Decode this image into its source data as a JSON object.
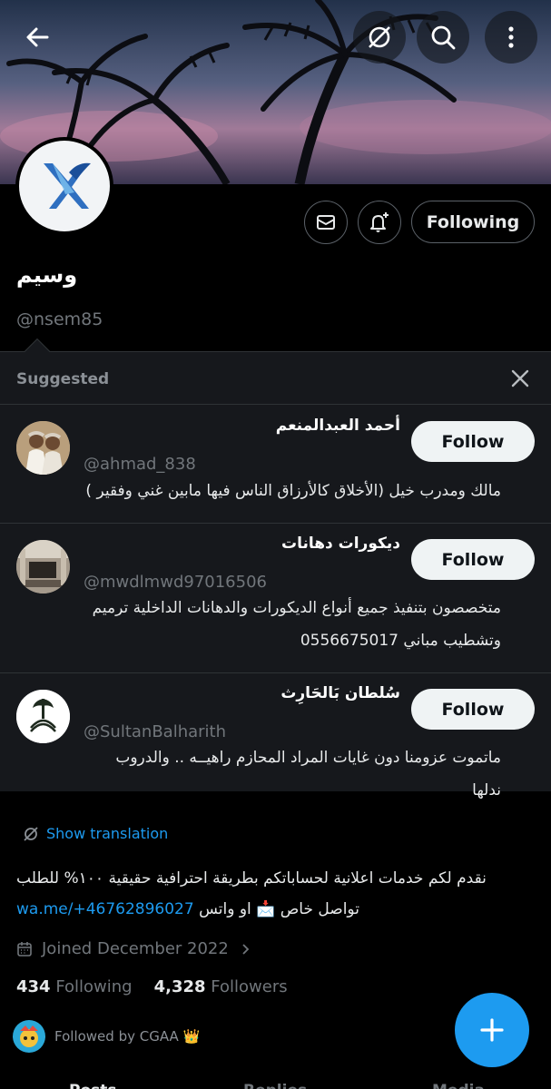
{
  "profile": {
    "display_name": "وسيم",
    "handle": "@nsem85",
    "following_label": "Following",
    "show_translation": "Show translation",
    "bio_text": "نقدم لكم خدمات اعلانية لحساباتكم بطريقة احترافية حقيقية ١٠٠% للطلب تواصل خاص 📩 او واتس",
    "bio_link": "wa.me/+46762896027",
    "joined": "Joined December 2022",
    "following_count": "434",
    "following_word": "Following",
    "followers_count": "4,328",
    "followers_word": "Followers",
    "followed_by": "Followed by CGAA 👑"
  },
  "suggested": {
    "title": "Suggested",
    "follow_label": "Follow",
    "items": [
      {
        "name": "أحمد العبدالمنعم",
        "handle": "@ahmad_838",
        "bio": "مالك ومدرب خيل (الأخلاق كالأرزاق الناس فيها مابين غني وفقير )"
      },
      {
        "name": "ديكورات دهانات",
        "handle": "@mwdlmwd97016506",
        "bio": "متخصصون بتنفيذ جميع أنواع  الديكورات والدهانات الداخلية ترميم وتشطيب مباني  0556675017"
      },
      {
        "name": "سُلطان بَالحَارِث",
        "handle": "@SultanBalharith",
        "bio": "ماتموت عزومنا دون غايات المراد  المحازم راهيــه .. والدروب ندلها"
      }
    ]
  },
  "tabs": [
    "Posts",
    "Replies",
    "Media"
  ],
  "colors": {
    "accent": "#1d9bf0",
    "background": "#000000",
    "panel": "#16181c",
    "muted": "#71767b"
  },
  "icons": [
    "back-arrow-icon",
    "translate-icon",
    "search-icon",
    "more-icon",
    "mail-icon",
    "bell-plus-icon",
    "close-icon",
    "calendar-icon",
    "chevron-right-icon",
    "plus-icon"
  ]
}
